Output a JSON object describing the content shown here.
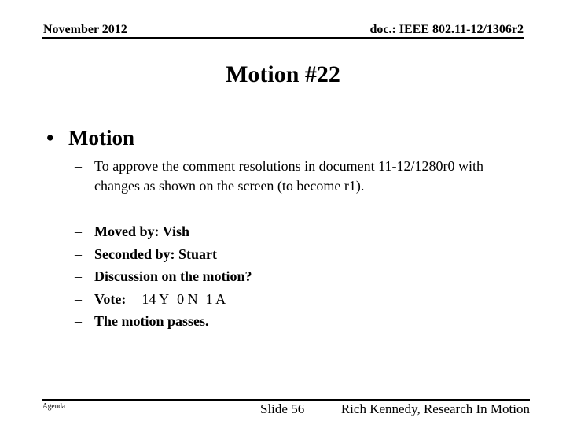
{
  "header": {
    "date": "November 2012",
    "doc_id": "doc.: IEEE 802.11-12/1306r2"
  },
  "title": "Motion #22",
  "body": {
    "bullet_symbol": "•",
    "level1": "Motion",
    "dash_symbol": "–",
    "description": "To approve the comment resolutions in document 11-12/1280r0 with changes as shown on the screen (to become r1).",
    "items": {
      "moved_by": "Moved by: Vish",
      "seconded_by": "Seconded by: Stuart",
      "discussion": "Discussion on the motion?",
      "vote_label": "Vote:",
      "vote_yes": "14 Y",
      "vote_no": "0 N",
      "vote_abstain": "1 A",
      "result": "The motion passes."
    }
  },
  "footer": {
    "left": "Agenda",
    "slide": "Slide 56",
    "author": "Rich Kennedy, Research In Motion"
  }
}
